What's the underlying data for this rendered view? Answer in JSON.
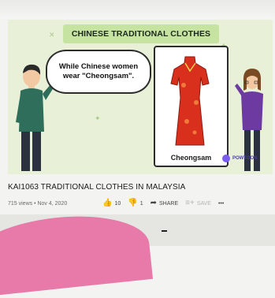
{
  "video": {
    "banner": "CHINESE TRADITIONAL CLOTHES",
    "speech": "While Chinese women\nwear \"Cheongsam\".",
    "card_caption": "Cheongsam",
    "brand": "POWTOON"
  },
  "title": "KAI1063 TRADITIONAL CLOTHES IN MALAYSIA",
  "meta": "715 views • Nov 4, 2020",
  "actions": {
    "like_count": "10",
    "dislike_count": "1",
    "share_label": "SHARE",
    "save_label": "SAVE",
    "more_label": "•••"
  },
  "colors": {
    "background": "#e8f1d8",
    "banner": "#c7e3a2",
    "dress": "#d9301e",
    "accent_pink": "#e77aa8"
  },
  "icons": [
    "like-icon",
    "dislike-icon",
    "share-icon",
    "save-icon",
    "more-icon"
  ]
}
